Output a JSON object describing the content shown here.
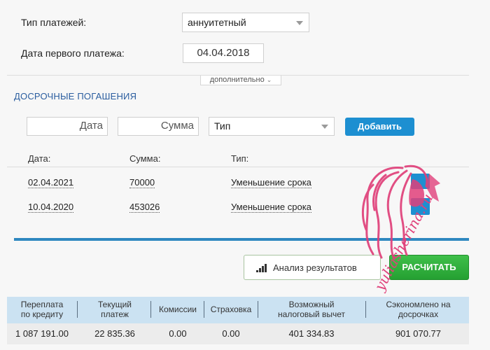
{
  "form": {
    "payment_type_label": "Тип платежей:",
    "payment_type_value": "аннуитетный",
    "first_payment_label": "Дата первого платежа:",
    "first_payment_value": "04.04.2018",
    "more_toggle": "дополнительно"
  },
  "prepay": {
    "title": "ДОСРОЧНЫЕ ПОГАШЕНИЯ",
    "date_placeholder": "Дата",
    "sum_placeholder": "Сумма",
    "type_value": "Тип",
    "add_button": "Добавить",
    "columns": [
      "Дата:",
      "Сумма:",
      "Тип:"
    ],
    "rows": [
      {
        "date": "02.04.2021",
        "sum": "70000",
        "type": "Уменьшение срока"
      },
      {
        "date": "10.04.2020",
        "sum": "453026",
        "type": "Уменьшение срока"
      }
    ]
  },
  "actions": {
    "analysis_button": "Анализ результатов",
    "calculate_button": "РАСЧИТАТЬ"
  },
  "results": {
    "headers": [
      [
        "Переплата",
        "по кредиту"
      ],
      [
        "Текущий",
        "платеж"
      ],
      [
        "Комиссии"
      ],
      [
        "Страховка"
      ],
      [
        "Возможный",
        "налоговый вычет"
      ],
      [
        "Сэкономлено на",
        "досрочках"
      ]
    ],
    "values": [
      "1 087 191.00",
      "22 835.36",
      "0.00",
      "0.00",
      "401 334.83",
      "901 070.77"
    ]
  },
  "watermark": {
    "text": "yuliasherina.ru"
  },
  "colors": {
    "accent_blue": "#1d8fd1",
    "calc_green": "#2aa838",
    "section_title": "#2a5d9f",
    "watermark": "#e0407a"
  }
}
